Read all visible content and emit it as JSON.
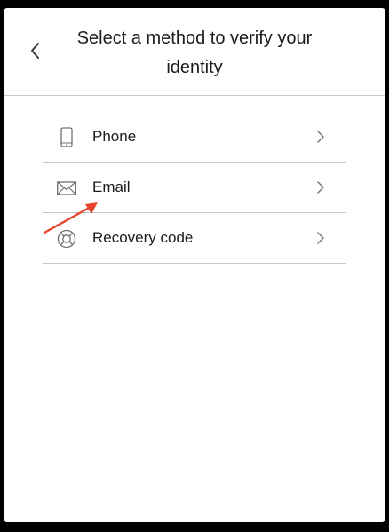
{
  "header": {
    "title": "Select a method to verify your identity",
    "back_icon": "chevron-left-icon"
  },
  "methods": [
    {
      "label": "Phone",
      "icon": "phone-icon"
    },
    {
      "label": "Email",
      "icon": "envelope-icon"
    },
    {
      "label": "Recovery code",
      "icon": "lifebuoy-icon"
    }
  ],
  "annotation": {
    "icon": "red-arrow",
    "color": "#e8452c"
  },
  "colors": {
    "background": "#000000",
    "card": "#ffffff",
    "text": "#1c1c1e",
    "icon": "#6e6e73",
    "divider": "#c6c6c8"
  }
}
